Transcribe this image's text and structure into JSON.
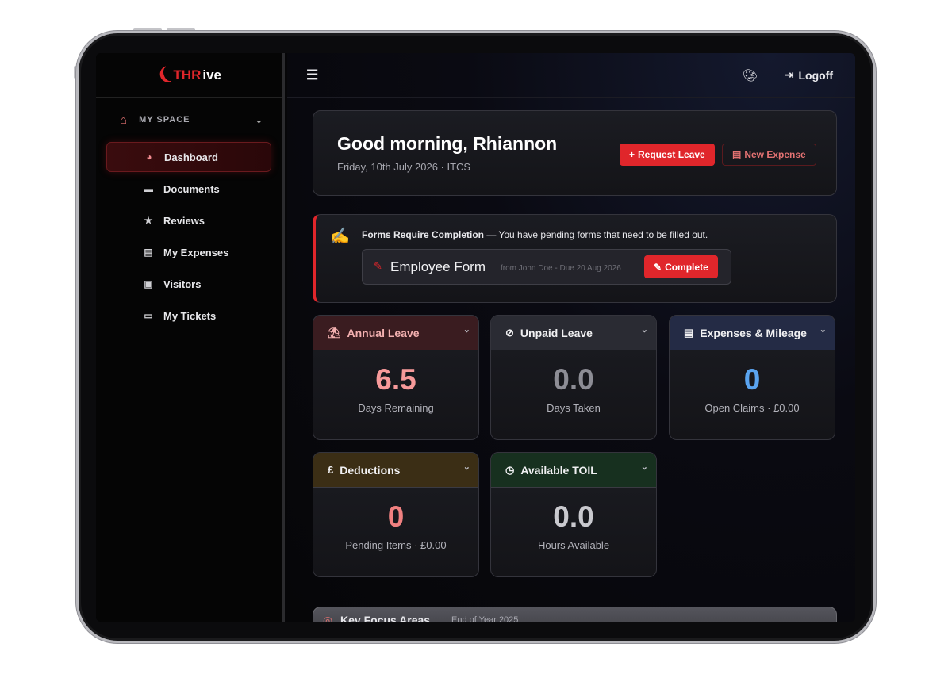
{
  "brand": {
    "name_red": "THR",
    "name_white": "ive"
  },
  "sidebar": {
    "section_label": "MY SPACE",
    "items": [
      {
        "label": "Dashboard",
        "icon": "gauge-icon",
        "glyph": "◕",
        "active": true
      },
      {
        "label": "Documents",
        "icon": "folder-icon",
        "glyph": "▬",
        "active": false
      },
      {
        "label": "Reviews",
        "icon": "star-icon",
        "glyph": "★",
        "active": false
      },
      {
        "label": "My Expenses",
        "icon": "receipt-icon",
        "glyph": "▤",
        "active": false
      },
      {
        "label": "Visitors",
        "icon": "badge-icon",
        "glyph": "▣",
        "active": false
      },
      {
        "label": "My Tickets",
        "icon": "ticket-icon",
        "glyph": "▭",
        "active": false
      }
    ]
  },
  "topbar": {
    "logoff_label": "Logoff"
  },
  "greeting": {
    "title": "Good morning, Rhiannon",
    "subtitle": "Friday, 10th July 2026 · ITCS",
    "request_leave_label": "Request Leave",
    "new_expense_label": "New Expense"
  },
  "forms": {
    "title": "Forms Require Completion",
    "message": " — You have pending forms that need to be filled out.",
    "form_name": "Employee Form",
    "form_meta": "from John Doe - Due 20 Aug 2026",
    "complete_label": "Complete"
  },
  "stats": {
    "annual": {
      "title": "Annual Leave",
      "value": "6.5",
      "caption": "Days Remaining",
      "color": "#f79a9a"
    },
    "unpaid": {
      "title": "Unpaid Leave",
      "value": "0.0",
      "caption": "Days Taken",
      "color": "#8d8d95"
    },
    "expenses": {
      "title": "Expenses & Mileage",
      "value": "0",
      "caption": "Open Claims · £0.00",
      "color": "#5aa4f0"
    },
    "deductions": {
      "title": "Deductions",
      "value": "0",
      "caption": "Pending Items · £0.00",
      "color": "#f08080"
    },
    "toil": {
      "title": "Available TOIL",
      "value": "0.0",
      "caption": "Hours Available",
      "color": "#c9c9ce"
    }
  },
  "focus": {
    "title": "Key Focus Areas",
    "subtitle": "End of Year 2025"
  }
}
